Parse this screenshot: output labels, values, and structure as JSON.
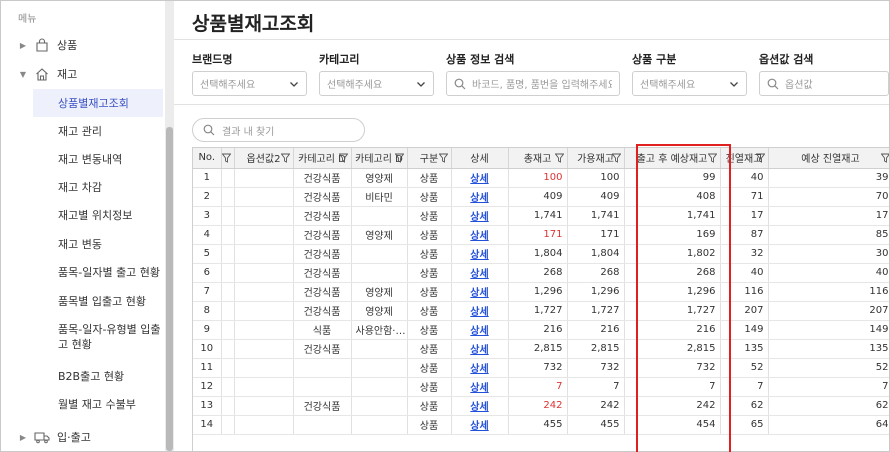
{
  "sidebar": {
    "header": "메뉴",
    "groups": [
      {
        "label": "상품",
        "icon": "bag-icon"
      },
      {
        "label": "재고",
        "icon": "home-icon"
      },
      {
        "label": "입·출고",
        "icon": "truck-icon"
      }
    ],
    "items": [
      "상품별재고조회",
      "재고 관리",
      "재고 변동내역",
      "재고 차감",
      "재고별 위치정보",
      "재고 변동",
      "품목-일자별 출고 현황",
      "품목별 입출고 현황",
      "품목-일자-유형별 입출고 현황",
      "B2B출고 현황",
      "월별 재고 수불부"
    ]
  },
  "page": {
    "title": "상품별재고조회"
  },
  "filters": [
    {
      "label": "브랜드명",
      "placeholder": "선택해주세요"
    },
    {
      "label": "카테고리",
      "placeholder": "선택해주세요"
    },
    {
      "label": "상품 정보 검색",
      "placeholder": "바코드, 품명, 품번을 입력해주세요"
    },
    {
      "label": "상품 구분",
      "placeholder": "선택해주세요"
    },
    {
      "label": "옵션값 검색",
      "placeholder": "옵션값"
    }
  ],
  "result_search": {
    "placeholder": "결과 내 찾기"
  },
  "table": {
    "columns": [
      "No.",
      "",
      "옵션값2",
      "카테고리 D",
      "카테고리 D",
      "구분",
      "상세",
      "총재고",
      "가용재고",
      "출고 후 예상재고",
      "진열재고",
      "예상 진열재고"
    ],
    "rows": [
      {
        "no": "1",
        "cat1": "건강식품",
        "cat2": "영양제",
        "type": "상품",
        "detail": "상세",
        "total": "100",
        "avail": "100",
        "after": "99",
        "disp": "40",
        "expdisp": "39",
        "red": true
      },
      {
        "no": "2",
        "cat1": "건강식품",
        "cat2": "비타민",
        "type": "상품",
        "detail": "상세",
        "total": "409",
        "avail": "409",
        "after": "408",
        "disp": "71",
        "expdisp": "70",
        "red": false
      },
      {
        "no": "3",
        "cat1": "건강식품",
        "cat2": "",
        "type": "상품",
        "detail": "상세",
        "total": "1,741",
        "avail": "1,741",
        "after": "1,741",
        "disp": "17",
        "expdisp": "17",
        "red": false
      },
      {
        "no": "4",
        "cat1": "건강식품",
        "cat2": "영양제",
        "type": "상품",
        "detail": "상세",
        "total": "171",
        "avail": "171",
        "after": "169",
        "disp": "87",
        "expdisp": "85",
        "red": true
      },
      {
        "no": "5",
        "cat1": "건강식품",
        "cat2": "",
        "type": "상품",
        "detail": "상세",
        "total": "1,804",
        "avail": "1,804",
        "after": "1,802",
        "disp": "32",
        "expdisp": "30",
        "red": false
      },
      {
        "no": "6",
        "cat1": "건강식품",
        "cat2": "",
        "type": "상품",
        "detail": "상세",
        "total": "268",
        "avail": "268",
        "after": "268",
        "disp": "40",
        "expdisp": "40",
        "red": false
      },
      {
        "no": "7",
        "cat1": "건강식품",
        "cat2": "영양제",
        "type": "상품",
        "detail": "상세",
        "total": "1,296",
        "avail": "1,296",
        "after": "1,296",
        "disp": "116",
        "expdisp": "116",
        "red": false
      },
      {
        "no": "8",
        "cat1": "건강식품",
        "cat2": "영양제",
        "type": "상품",
        "detail": "상세",
        "total": "1,727",
        "avail": "1,727",
        "after": "1,727",
        "disp": "207",
        "expdisp": "207",
        "red": false
      },
      {
        "no": "9",
        "cat1": "식품",
        "cat2": "사용안함·…",
        "type": "상품",
        "detail": "상세",
        "total": "216",
        "avail": "216",
        "after": "216",
        "disp": "149",
        "expdisp": "149",
        "red": false
      },
      {
        "no": "10",
        "cat1": "건강식품",
        "cat2": "",
        "type": "상품",
        "detail": "상세",
        "total": "2,815",
        "avail": "2,815",
        "after": "2,815",
        "disp": "135",
        "expdisp": "135",
        "red": false
      },
      {
        "no": "11",
        "cat1": "",
        "cat2": "",
        "type": "상품",
        "detail": "상세",
        "total": "732",
        "avail": "732",
        "after": "732",
        "disp": "52",
        "expdisp": "52",
        "red": false
      },
      {
        "no": "12",
        "cat1": "",
        "cat2": "",
        "type": "상품",
        "detail": "상세",
        "total": "7",
        "avail": "7",
        "after": "7",
        "disp": "7",
        "expdisp": "7",
        "red": true
      },
      {
        "no": "13",
        "cat1": "건강식품",
        "cat2": "",
        "type": "상품",
        "detail": "상세",
        "total": "242",
        "avail": "242",
        "after": "242",
        "disp": "62",
        "expdisp": "62",
        "red": true
      },
      {
        "no": "14",
        "cat1": "",
        "cat2": "",
        "type": "상품",
        "detail": "상세",
        "total": "455",
        "avail": "455",
        "after": "454",
        "disp": "65",
        "expdisp": "64",
        "red": false
      }
    ]
  },
  "colors": {
    "accent": "#3a51c4",
    "link": "#2350d8",
    "highlight_box": "#e01f1f",
    "low_stock": "#d33333"
  }
}
